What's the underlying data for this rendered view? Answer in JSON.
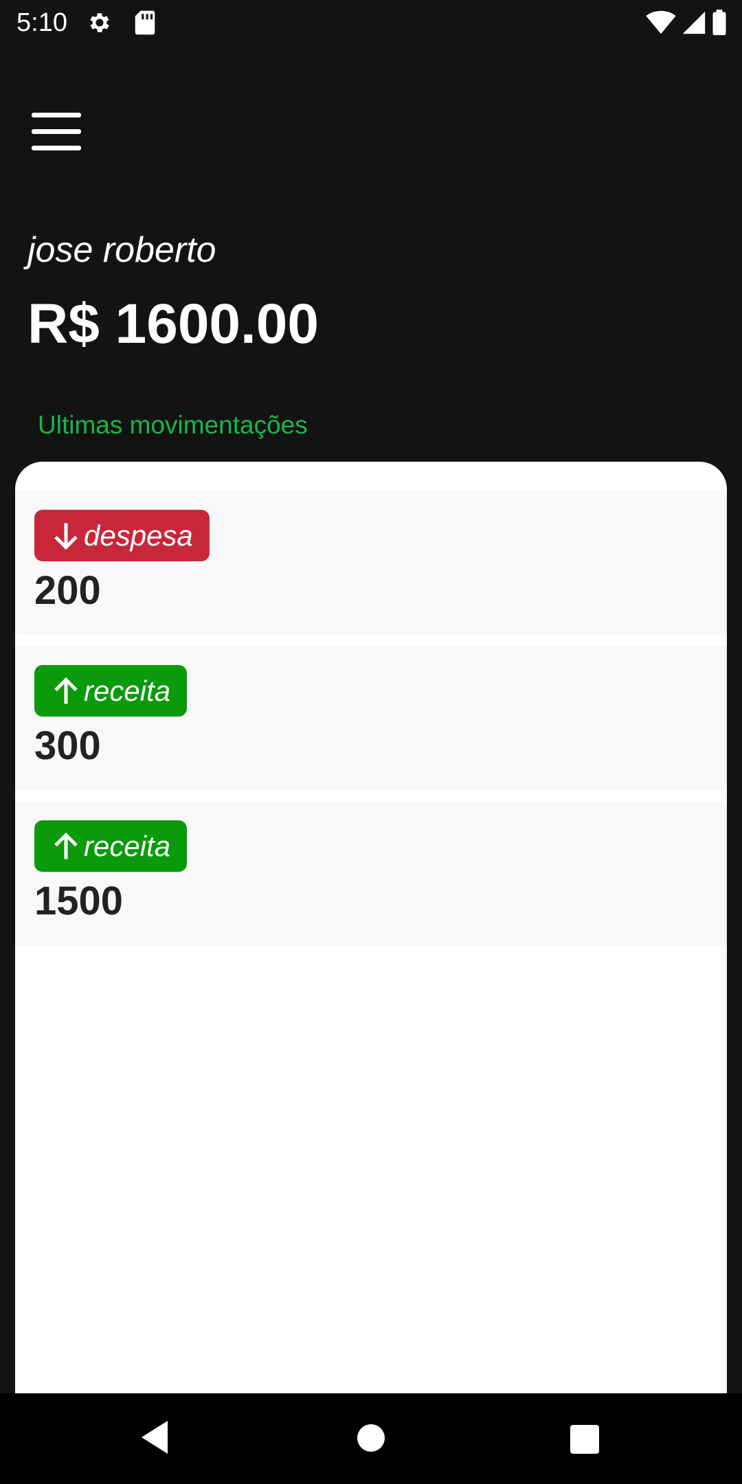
{
  "status_bar": {
    "time": "5:10",
    "icons": [
      "gear-icon",
      "sd-card-icon",
      "wifi-icon",
      "signal-icon",
      "battery-icon"
    ]
  },
  "header": {
    "menu_icon": "hamburger-menu-icon",
    "user_name": "jose roberto",
    "balance": "R$ 1600.00"
  },
  "movements_section": {
    "title": "Ultimas movimentações",
    "items": [
      {
        "type": "despesa",
        "icon": "arrow-down-icon",
        "value": "200",
        "color": "#c8273a"
      },
      {
        "type": "receita",
        "icon": "arrow-up-icon",
        "value": "300",
        "color": "#0a9a0a"
      },
      {
        "type": "receita",
        "icon": "arrow-up-icon",
        "value": "1500",
        "color": "#0a9a0a"
      }
    ]
  },
  "nav_bar": {
    "buttons": [
      "back-icon",
      "home-icon",
      "recents-icon"
    ]
  },
  "colors": {
    "background": "#131313",
    "accent_green": "#16b84a",
    "expense_red": "#c8273a",
    "income_green": "#0a9a0a"
  }
}
